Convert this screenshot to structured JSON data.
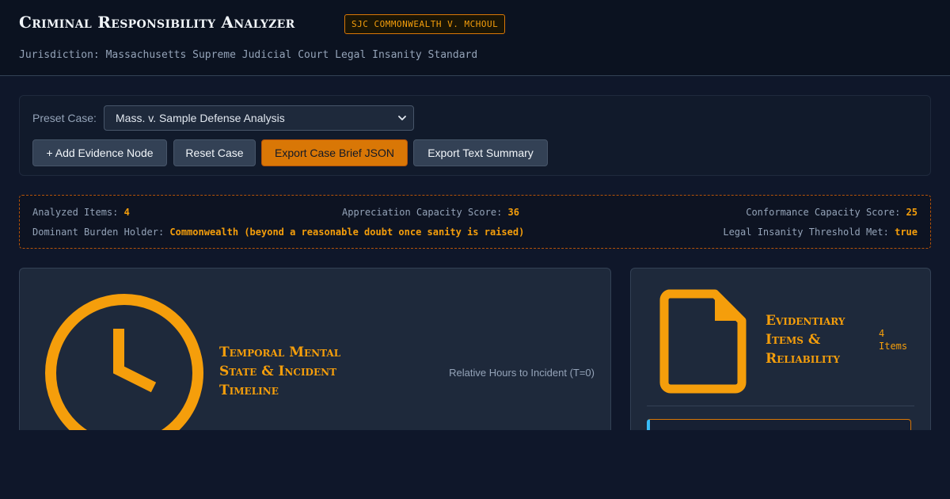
{
  "header": {
    "title": "Criminal Responsibility Analyzer",
    "badge": "SJC COMMONWEALTH V. MCHOUL",
    "jurisdiction": "Jurisdiction: Massachusetts Supreme Judicial Court Legal Insanity Standard"
  },
  "controls": {
    "preset_label": "Preset Case:",
    "preset_value": "Mass. v. Sample Defense Analysis",
    "buttons": {
      "add_evidence": "+ Add Evidence Node",
      "reset_case": "Reset Case",
      "export_json": "Export Case Brief JSON",
      "export_text": "Export Text Summary"
    }
  },
  "stats": {
    "analyzed_label": "Analyzed Items:",
    "analyzed_value": "4",
    "appreciation_label": "Appreciation Capacity Score:",
    "appreciation_value": "36",
    "conformance_label": "Conformance Capacity Score:",
    "conformance_value": "25",
    "burden_label": "Dominant Burden Holder:",
    "burden_value": "Commonwealth (beyond a reasonable doubt once sanity is raised)",
    "threshold_label": "Legal Insanity Threshold Met:",
    "threshold_value": "true"
  },
  "timeline": {
    "icon": "clock-icon",
    "title": "Temporal Mental State & Incident Timeline",
    "axis_caption": "Relative Hours to Incident (T=0)"
  },
  "evidence": {
    "icon": "document-icon",
    "title": "Evidentiary Items & Reliability",
    "count": "4 Items"
  },
  "colors": {
    "accent": "#f59e0b",
    "accent_dark": "#d97706",
    "background": "#0f172a",
    "panel": "#1e293b",
    "card_stripe": "#38bdf8"
  }
}
